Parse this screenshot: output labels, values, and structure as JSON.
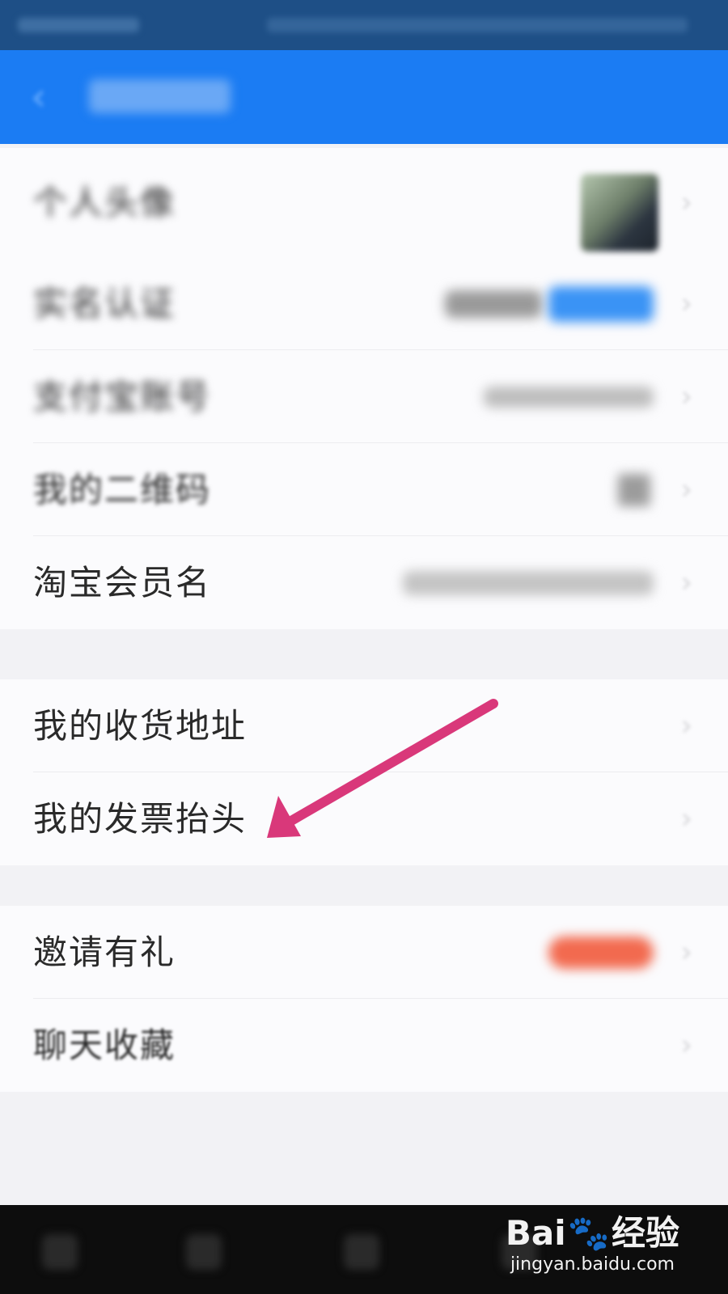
{
  "nav": {
    "back_icon": "chevron-left-icon",
    "title": "个人信息"
  },
  "profile_group": {
    "items": [
      {
        "label": "个人头像",
        "value": ""
      },
      {
        "label": "实名认证",
        "value": ""
      },
      {
        "label": "支付宝账号",
        "value": ""
      },
      {
        "label": "我的二维码",
        "value": ""
      },
      {
        "label": "淘宝会员名",
        "value": ""
      }
    ]
  },
  "address_group": {
    "items": [
      {
        "label": "我的收货地址"
      },
      {
        "label": "我的发票抬头"
      }
    ]
  },
  "misc_group": {
    "items": [
      {
        "label": "邀请有礼"
      },
      {
        "label": "聊天收藏"
      }
    ]
  },
  "chevron_glyph": "›",
  "colors": {
    "nav_blue": "#1b7cf3",
    "status_bar": "#1e4f86",
    "annotation_arrow": "#d9387a",
    "badge_red": "#f26a4f",
    "verify_blue": "#3a93f5"
  },
  "watermark": {
    "brand": "Bai",
    "brand_suffix": "经验",
    "url": "jingyan.baidu.com"
  }
}
